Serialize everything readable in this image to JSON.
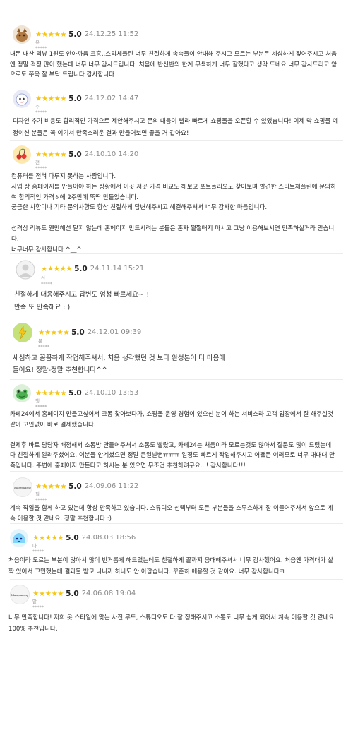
{
  "star_glyphs": "★★★★★",
  "reviews": [
    {
      "score": "5.0",
      "date": "24.12.25 11:52",
      "user": "유*****",
      "avatar_icon": "fox-doll-icon",
      "avatar_color": "#b07a45",
      "text": "내돈 내산 리뷰 1원도 안아까움 크흥..스티체플린 너무 친절하게 속속들이 안내해 주시고 모르는 부분은 세심하게 짚어주시고 처음\n엔 정말 걱정 많이 했는데 너무 너무 감사드립니다. 처음에 반신반의 한계 무색하게 너무 잘했다고 생각 드네요 너무 감사드리고 앞\n으로도 쭈욱 잘 부탁 드립니다 감사합니다"
    },
    {
      "score": "5.0",
      "date": "24.12.02 14:47",
      "user": "주*****",
      "avatar_icon": "cartoon-face-icon",
      "avatar_color": "#9fa8da",
      "text": "디자인 추가 비용도 합리적인 가격으로 제안해주시고 문의 대응이 빨라 빠르게 쇼핑몰을 오픈할 수 있었습니다! 이제 막 쇼핑몰 예\n정이신 분들은 꼭 여기서 만족스러운 결과 만들어보면 좋을 거 같아요!"
    },
    {
      "score": "5.0",
      "date": "24.10.10 14:20",
      "user": "전*****",
      "avatar_icon": "cherry-icon",
      "avatar_color": "#fde8b0",
      "text": "컴퓨터를 전혀 다루지 못하는 사람입니다.\n사업 상 홈페이지를 만들어야 하는 상황에서 이곳 저곳 가격 비교도 해보고 포트폴리오도 찾아보며 발견한 스티트체플린에 문의하\n여 합리적인 가격ㅎ에 2주만에 뚝딱 만들었습니다.\n궁금한 사항이나 기타 문의사항도 항상 친절하게 답변해주시고 해결해주셔서 너무 감사한 마음입니다.\n\n성격상 리뷰도 웬만해선 달지 않는데 홈페이지 만드시려는 분들은 혼자 쩔쩔매지 마시고 그냥 이용해보시면 만족하실거라 믿습니\n다.\n너무너무 감사합니다 ^__^"
    },
    {
      "score": "5.0",
      "date": "24.11.14 15:21",
      "user": "신*****",
      "avatar_icon": "default-user-icon",
      "avatar_color": "#d8d8d8",
      "text": "친절하게 대응해주시고 답변도 엄청 빠르세요~!!\n만족 또 만족해요 : )"
    },
    {
      "score": "5.0",
      "date": "24.12.01 09:39",
      "user": "분*****",
      "avatar_icon": "lightning-icon",
      "avatar_color": "#c5e17a",
      "text": "세심하고 꼼꼼하게 작업해주셔서, 처음 생각했던 것 보다 완성본이 더 마음에\n들어요! 정말-정말 추천합니다^^"
    },
    {
      "score": "5.0",
      "date": "24.10.10 13:53",
      "user": "행*****",
      "avatar_icon": "frog-icon",
      "avatar_color": "#dcefd8",
      "text": "카페24에서 홈페이지 만들고싶어서 크몽 찾아보다가, 쇼핑몰 운영 경험이 있으신 분이 하는 서비스라 고객 입장에서 잘 해주실것\n같아 고민없이 바로 결제했습니다.\n\n결제후 바로 담당자 배정해서 소통방 만들어주셔서 소통도 빨랐고, 카페24는 처음이라 모르는것도 많아서 질문도 많이 드렸는데\n다 친절하게 알려주셨어요. 이분들 안계셨으면 정말 큰일날뻔ㅠㅠㅠ 일정도 빠르게 작업해주시고 어쨌든 여러모로 너무 대대대 만\n족입니다. 주변에 홈페이지 만든다고 하시는 분 있으면 무조건 추천하려구요...! 감사합니다!!!"
    },
    {
      "score": "5.0",
      "date": "24.09.06 11:22",
      "user": "필*****",
      "avatar_icon": "manymarny-logo-icon",
      "avatar_color": "#f5f5f5",
      "avatar_text": "Manymarny",
      "text": "계속 작업을 함께 하고 있는데 항상 만족하고 있습니다. 스튜디오 선택부터 모든 부분들을 스무스하게 잘 이끌어주셔서 앞으로 계\n속 이용할 것 같네요. 정말 추천합니다 :)"
    },
    {
      "score": "5.0",
      "date": "24.08.03 18:56",
      "user": "나*****",
      "avatar_icon": "blue-slime-icon",
      "avatar_color": "#bfe6f7",
      "text": "처음이라 모르는 부분이 많아서 많이 번거롭게 해드렸는데도 친절하게 끝까지 응대해주셔서 너무 감사했어요. 처음엔 가격대가 살\n짝 있어서 고민했는데 결과물 받고 나니까 하나도 안 아깝습니다. 꾸준히 애용할 것 같아요. 너무 감사합니다ㅋ"
    },
    {
      "score": "5.0",
      "date": "24.06.08 19:04",
      "user": "말*****",
      "avatar_icon": "manymarny-logo-icon",
      "avatar_color": "#f5f5f5",
      "avatar_text": "Manymarny",
      "text": "너무 만족합니다! 저희 옷 스타일에 맞는 사진 무드, 스튜디오도 다 잘 정해주시고 소통도 너무 쉽게 되어서 계속 이용할 것 같네요.\n100% 추천입니다."
    }
  ]
}
